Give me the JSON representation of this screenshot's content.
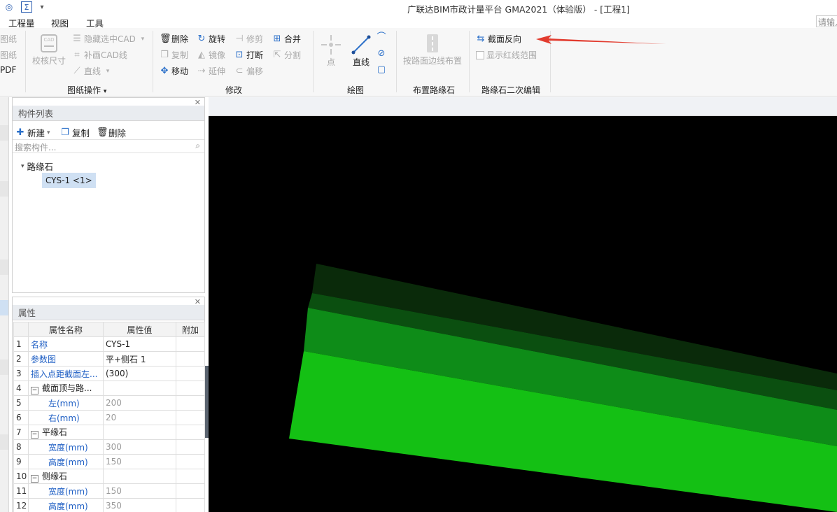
{
  "app": {
    "title": "广联达BIM市政计量平台 GMA2021（体验版） - [工程1]"
  },
  "menu": {
    "items": [
      "工程量",
      "视图",
      "工具"
    ],
    "search_placeholder": "请输入"
  },
  "ribbon": {
    "drawing_ops": {
      "label": "图纸操作",
      "partial_left": [
        "图纸",
        "图纸",
        "PDF"
      ],
      "check_dims": "校核尺寸",
      "hide_cad": "隐藏选中CAD",
      "draw_cad_line": "补画CAD线",
      "straight_line": "直线"
    },
    "modify": {
      "label": "修改",
      "delete": "删除",
      "rotate": "旋转",
      "trim": "修剪",
      "merge": "合并",
      "copy": "复制",
      "mirror": "镜像",
      "break": "打断",
      "split": "分割",
      "move": "移动",
      "extend": "延伸",
      "offset": "偏移"
    },
    "draw": {
      "label": "绘图",
      "point": "点",
      "line": "直线"
    },
    "place_curb": {
      "label": "布置路缘石",
      "by_road_edge": "按路面边线布置"
    },
    "curb_edit": {
      "label": "路缘石二次编辑",
      "reverse_section": "截面反向",
      "show_red_line": "显示红线范围"
    }
  },
  "component_list": {
    "title": "构件列表",
    "new": "新建",
    "copy": "复制",
    "delete": "删除",
    "search_placeholder": "搜索构件...",
    "tree_root": "路缘石",
    "tree_leaf": "CYS-1 <1>"
  },
  "properties": {
    "title": "属性",
    "headers": [
      "属性名称",
      "属性值",
      "附加"
    ],
    "rows": [
      {
        "n": "1",
        "name": "名称",
        "value": "CYS-1"
      },
      {
        "n": "2",
        "name": "参数图",
        "value": "平+侧石 1"
      },
      {
        "n": "3",
        "name": "插入点距截面左...",
        "value": "(300)"
      },
      {
        "n": "4",
        "name": "截面顶与路...",
        "value": ""
      },
      {
        "n": "5",
        "name": "左(mm)",
        "value": "200"
      },
      {
        "n": "6",
        "name": "右(mm)",
        "value": "20"
      },
      {
        "n": "7",
        "name": "平缘石",
        "value": ""
      },
      {
        "n": "8",
        "name": "宽度(mm)",
        "value": "300"
      },
      {
        "n": "9",
        "name": "高度(mm)",
        "value": "150"
      },
      {
        "n": "10",
        "name": "侧缘石",
        "value": ""
      },
      {
        "n": "11",
        "name": "宽度(mm)",
        "value": "150"
      },
      {
        "n": "12",
        "name": "高度(mm)",
        "value": "350"
      }
    ]
  },
  "colors": {
    "accent_blue": "#2a6fc9",
    "property_name_blue": "#1f5fc4",
    "canvas_bg": "#000000",
    "curb_darkest": "#0a2a0a",
    "curb_dark": "#0b4f10",
    "curb_mid": "#0e8c18",
    "curb_bright": "#14c014",
    "annotation_arrow": "#e23b2e"
  }
}
